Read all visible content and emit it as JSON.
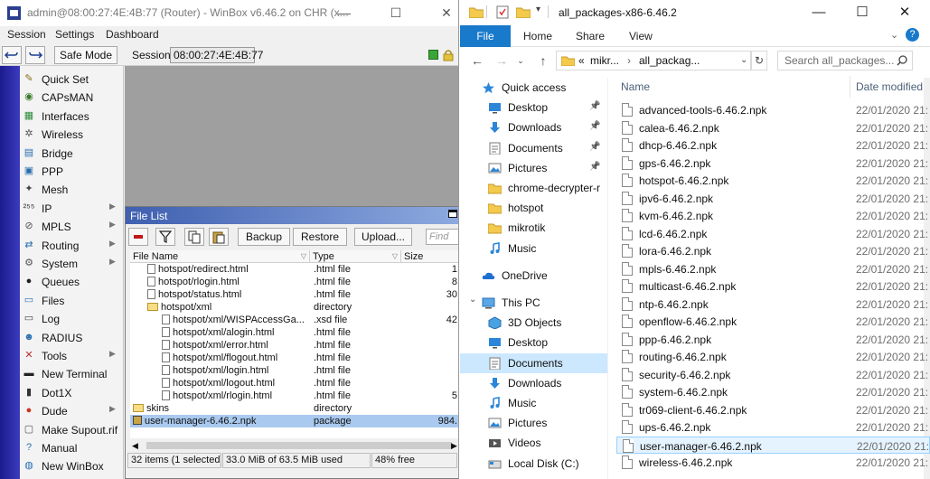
{
  "winbox": {
    "title": "admin@08:00:27:4E:4B:77 (Router) - WinBox v6.46.2 on CHR (x...",
    "window_controls": [
      "—",
      "☐",
      "✕"
    ],
    "menu": [
      "Session",
      "Settings",
      "Dashboard"
    ],
    "toolbar": {
      "undo_icon": "undo-icon",
      "redo_icon": "redo-icon",
      "safe_mode": "Safe Mode",
      "session_label": "Session:",
      "session_value": "08:00:27:4E:4B:77"
    },
    "sidebar": [
      {
        "label": "Quick Set",
        "icon": "quick-set-icon",
        "glyph": "✎",
        "color": "#8a6d1c",
        "arrow": false
      },
      {
        "label": "CAPsMAN",
        "icon": "capsman-icon",
        "glyph": "◉",
        "color": "#3a7a2a",
        "arrow": false
      },
      {
        "label": "Interfaces",
        "icon": "interfaces-icon",
        "glyph": "▦",
        "color": "#2f8a3a",
        "arrow": false
      },
      {
        "label": "Wireless",
        "icon": "wireless-icon",
        "glyph": "✲",
        "color": "#555555",
        "arrow": false
      },
      {
        "label": "Bridge",
        "icon": "bridge-icon",
        "glyph": "▤",
        "color": "#2a6fb0",
        "arrow": false
      },
      {
        "label": "PPP",
        "icon": "ppp-icon",
        "glyph": "▣",
        "color": "#2a6fb0",
        "arrow": false
      },
      {
        "label": "Mesh",
        "icon": "mesh-icon",
        "glyph": "✦",
        "color": "#444444",
        "arrow": false
      },
      {
        "label": "IP",
        "icon": "ip-icon",
        "glyph": "²⁵⁵",
        "color": "#333333",
        "arrow": true
      },
      {
        "label": "MPLS",
        "icon": "mpls-icon",
        "glyph": "⊘",
        "color": "#555555",
        "arrow": true
      },
      {
        "label": "Routing",
        "icon": "routing-icon",
        "glyph": "⇄",
        "color": "#2a6fb0",
        "arrow": true
      },
      {
        "label": "System",
        "icon": "system-icon",
        "glyph": "⚙",
        "color": "#555555",
        "arrow": true
      },
      {
        "label": "Queues",
        "icon": "queues-icon",
        "glyph": "●",
        "color": "#222222",
        "arrow": false
      },
      {
        "label": "Files",
        "icon": "files-icon",
        "glyph": "▭",
        "color": "#2a6fb0",
        "arrow": false
      },
      {
        "label": "Log",
        "icon": "log-icon",
        "glyph": "▭",
        "color": "#444444",
        "arrow": false
      },
      {
        "label": "RADIUS",
        "icon": "radius-icon",
        "glyph": "☻",
        "color": "#2a6fb0",
        "arrow": false
      },
      {
        "label": "Tools",
        "icon": "tools-icon",
        "glyph": "✕",
        "color": "#b03030",
        "arrow": true
      },
      {
        "label": "New Terminal",
        "icon": "terminal-icon",
        "glyph": "▬",
        "color": "#222222",
        "arrow": false
      },
      {
        "label": "Dot1X",
        "icon": "dot1x-icon",
        "glyph": "▮",
        "color": "#333333",
        "arrow": false
      },
      {
        "label": "Dude",
        "icon": "dude-icon",
        "glyph": "●",
        "color": "#d03020",
        "arrow": true
      },
      {
        "label": "Make Supout.rif",
        "icon": "supout-icon",
        "glyph": "▢",
        "color": "#555555",
        "arrow": false
      },
      {
        "label": "Manual",
        "icon": "manual-icon",
        "glyph": "?",
        "color": "#2a6fb0",
        "arrow": false
      },
      {
        "label": "New WinBox",
        "icon": "new-winbox-icon",
        "glyph": "◍",
        "color": "#2a6fb0",
        "arrow": false
      }
    ],
    "file_list": {
      "title": "File List",
      "buttons": {
        "backup": "Backup",
        "restore": "Restore",
        "upload": "Upload..."
      },
      "find_placeholder": "Find",
      "columns": [
        "File Name",
        "Type",
        "Size"
      ],
      "rows": [
        {
          "indent": 2,
          "icon": "file",
          "name": "hotspot/redirect.html",
          "type": ".html file",
          "size": "1",
          "selected": false
        },
        {
          "indent": 2,
          "icon": "file",
          "name": "hotspot/rlogin.html",
          "type": ".html file",
          "size": "8",
          "selected": false
        },
        {
          "indent": 2,
          "icon": "file",
          "name": "hotspot/status.html",
          "type": ".html file",
          "size": "30",
          "selected": false
        },
        {
          "indent": 2,
          "icon": "folder",
          "name": "hotspot/xml",
          "type": "directory",
          "size": "",
          "selected": false
        },
        {
          "indent": 3,
          "icon": "file",
          "name": "hotspot/xml/WISPAccessGa...",
          "type": ".xsd file",
          "size": "42",
          "selected": false
        },
        {
          "indent": 3,
          "icon": "file",
          "name": "hotspot/xml/alogin.html",
          "type": ".html file",
          "size": "",
          "selected": false
        },
        {
          "indent": 3,
          "icon": "file",
          "name": "hotspot/xml/error.html",
          "type": ".html file",
          "size": "",
          "selected": false
        },
        {
          "indent": 3,
          "icon": "file",
          "name": "hotspot/xml/flogout.html",
          "type": ".html file",
          "size": "",
          "selected": false
        },
        {
          "indent": 3,
          "icon": "file",
          "name": "hotspot/xml/login.html",
          "type": ".html file",
          "size": "",
          "selected": false
        },
        {
          "indent": 3,
          "icon": "file",
          "name": "hotspot/xml/logout.html",
          "type": ".html file",
          "size": "",
          "selected": false
        },
        {
          "indent": 3,
          "icon": "file",
          "name": "hotspot/xml/rlogin.html",
          "type": ".html file",
          "size": "5",
          "selected": false
        },
        {
          "indent": 1,
          "icon": "folder",
          "name": "skins",
          "type": "directory",
          "size": "",
          "selected": false
        },
        {
          "indent": 1,
          "icon": "package",
          "name": "user-manager-6.46.2.npk",
          "type": "package",
          "size": "984.",
          "selected": true
        }
      ],
      "status": {
        "items": "32 items (1 selected)",
        "usage": "33.0 MiB of 63.5 MiB used",
        "free": "48% free"
      }
    }
  },
  "explorer": {
    "title": "all_packages-x86-6.46.2",
    "window_controls": [
      "—",
      "☐",
      "✕"
    ],
    "ribbon": {
      "file": "File",
      "tabs": [
        "Home",
        "Share",
        "View"
      ]
    },
    "address": {
      "path_prefix": "«",
      "path": [
        "mikr...",
        "all_packag..."
      ],
      "separator": "›",
      "search_placeholder": "Search all_packages..."
    },
    "nav": [
      {
        "label": "Quick access",
        "icon": "star-icon",
        "level": 0,
        "pinned": false,
        "selected": false
      },
      {
        "label": "Desktop",
        "icon": "desktop-icon",
        "level": 1,
        "pinned": true,
        "selected": false
      },
      {
        "label": "Downloads",
        "icon": "downloads-icon",
        "level": 1,
        "pinned": true,
        "selected": false
      },
      {
        "label": "Documents",
        "icon": "documents-icon",
        "level": 1,
        "pinned": true,
        "selected": false
      },
      {
        "label": "Pictures",
        "icon": "pictures-icon",
        "level": 1,
        "pinned": true,
        "selected": false
      },
      {
        "label": "chrome-decrypter-r",
        "icon": "folder-icon",
        "level": 1,
        "pinned": false,
        "selected": false
      },
      {
        "label": "hotspot",
        "icon": "folder-icon",
        "level": 1,
        "pinned": false,
        "selected": false
      },
      {
        "label": "mikrotik",
        "icon": "folder-icon",
        "level": 1,
        "pinned": false,
        "selected": false
      },
      {
        "label": "Music",
        "icon": "music-icon",
        "level": 1,
        "pinned": false,
        "selected": false
      },
      {
        "label": "OneDrive",
        "icon": "onedrive-icon",
        "level": 0,
        "pinned": false,
        "selected": false
      },
      {
        "label": "This PC",
        "icon": "this-pc-icon",
        "level": 0,
        "pinned": false,
        "selected": false
      },
      {
        "label": "3D Objects",
        "icon": "3d-objects-icon",
        "level": 1,
        "pinned": false,
        "selected": false
      },
      {
        "label": "Desktop",
        "icon": "desktop-icon",
        "level": 1,
        "pinned": false,
        "selected": false
      },
      {
        "label": "Documents",
        "icon": "documents-icon",
        "level": 1,
        "pinned": false,
        "selected": true
      },
      {
        "label": "Downloads",
        "icon": "downloads-icon",
        "level": 1,
        "pinned": false,
        "selected": false
      },
      {
        "label": "Music",
        "icon": "music-icon",
        "level": 1,
        "pinned": false,
        "selected": false
      },
      {
        "label": "Pictures",
        "icon": "pictures-icon",
        "level": 1,
        "pinned": false,
        "selected": false
      },
      {
        "label": "Videos",
        "icon": "videos-icon",
        "level": 1,
        "pinned": false,
        "selected": false
      },
      {
        "label": "Local Disk (C:)",
        "icon": "local-disk-icon",
        "level": 1,
        "pinned": false,
        "selected": false
      }
    ],
    "columns": {
      "name": "Name",
      "date": "Date modified"
    },
    "files": [
      {
        "name": "advanced-tools-6.46.2.npk",
        "date": "22/01/2020 21:",
        "selected": false
      },
      {
        "name": "calea-6.46.2.npk",
        "date": "22/01/2020 21:",
        "selected": false
      },
      {
        "name": "dhcp-6.46.2.npk",
        "date": "22/01/2020 21:",
        "selected": false
      },
      {
        "name": "gps-6.46.2.npk",
        "date": "22/01/2020 21:",
        "selected": false
      },
      {
        "name": "hotspot-6.46.2.npk",
        "date": "22/01/2020 21:",
        "selected": false
      },
      {
        "name": "ipv6-6.46.2.npk",
        "date": "22/01/2020 21:",
        "selected": false
      },
      {
        "name": "kvm-6.46.2.npk",
        "date": "22/01/2020 21:",
        "selected": false
      },
      {
        "name": "lcd-6.46.2.npk",
        "date": "22/01/2020 21:",
        "selected": false
      },
      {
        "name": "lora-6.46.2.npk",
        "date": "22/01/2020 21:",
        "selected": false
      },
      {
        "name": "mpls-6.46.2.npk",
        "date": "22/01/2020 21:",
        "selected": false
      },
      {
        "name": "multicast-6.46.2.npk",
        "date": "22/01/2020 21:",
        "selected": false
      },
      {
        "name": "ntp-6.46.2.npk",
        "date": "22/01/2020 21:",
        "selected": false
      },
      {
        "name": "openflow-6.46.2.npk",
        "date": "22/01/2020 21:",
        "selected": false
      },
      {
        "name": "ppp-6.46.2.npk",
        "date": "22/01/2020 21:",
        "selected": false
      },
      {
        "name": "routing-6.46.2.npk",
        "date": "22/01/2020 21:",
        "selected": false
      },
      {
        "name": "security-6.46.2.npk",
        "date": "22/01/2020 21:",
        "selected": false
      },
      {
        "name": "system-6.46.2.npk",
        "date": "22/01/2020 21:",
        "selected": false
      },
      {
        "name": "tr069-client-6.46.2.npk",
        "date": "22/01/2020 21:",
        "selected": false
      },
      {
        "name": "ups-6.46.2.npk",
        "date": "22/01/2020 21:",
        "selected": false
      },
      {
        "name": "user-manager-6.46.2.npk",
        "date": "22/01/2020 21:",
        "selected": true
      },
      {
        "name": "wireless-6.46.2.npk",
        "date": "22/01/2020 21:",
        "selected": false
      }
    ]
  }
}
